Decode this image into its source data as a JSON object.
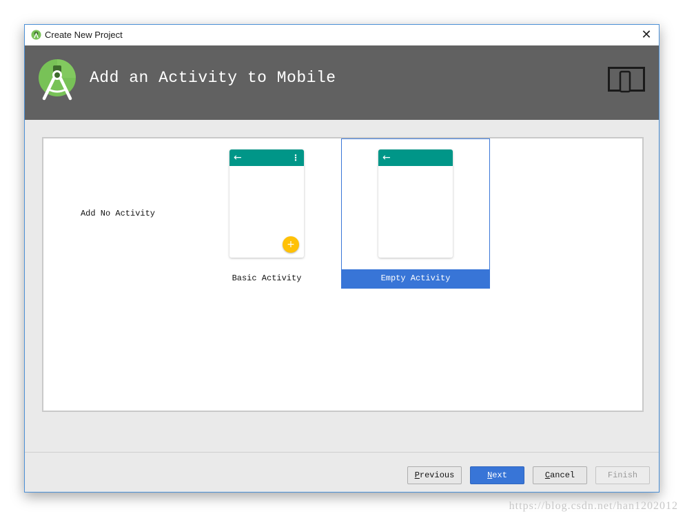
{
  "window": {
    "title": "Create New Project",
    "close_glyph": "✕"
  },
  "header": {
    "title": "Add an Activity to Mobile",
    "logo_icon": "android-studio-logo",
    "device_icon": "phone-tablet-icon"
  },
  "gallery": {
    "items": [
      {
        "label": "Add No Activity",
        "selected": false
      },
      {
        "label": "Basic Activity",
        "selected": false,
        "has_fab": true,
        "has_overflow_menu": true
      },
      {
        "label": "Empty Activity",
        "selected": true
      }
    ]
  },
  "preview": {
    "back_arrow": "←",
    "overflow_menu": "⋮",
    "fab_glyph": "+"
  },
  "buttons": {
    "previous": {
      "mnemonic": "P",
      "rest": "revious",
      "enabled": true
    },
    "next": {
      "mnemonic": "N",
      "rest": "ext",
      "enabled": true
    },
    "cancel": {
      "mnemonic": "C",
      "rest": "ancel",
      "enabled": true
    },
    "finish": {
      "mnemonic": "",
      "rest": "Finish",
      "enabled": false
    }
  },
  "colors": {
    "header_bg": "#616161",
    "toolbar_teal": "#009688",
    "fab_amber": "#ffc107",
    "selection_blue": "#3875d7"
  },
  "watermark": "https://blog.csdn.net/han1202012"
}
